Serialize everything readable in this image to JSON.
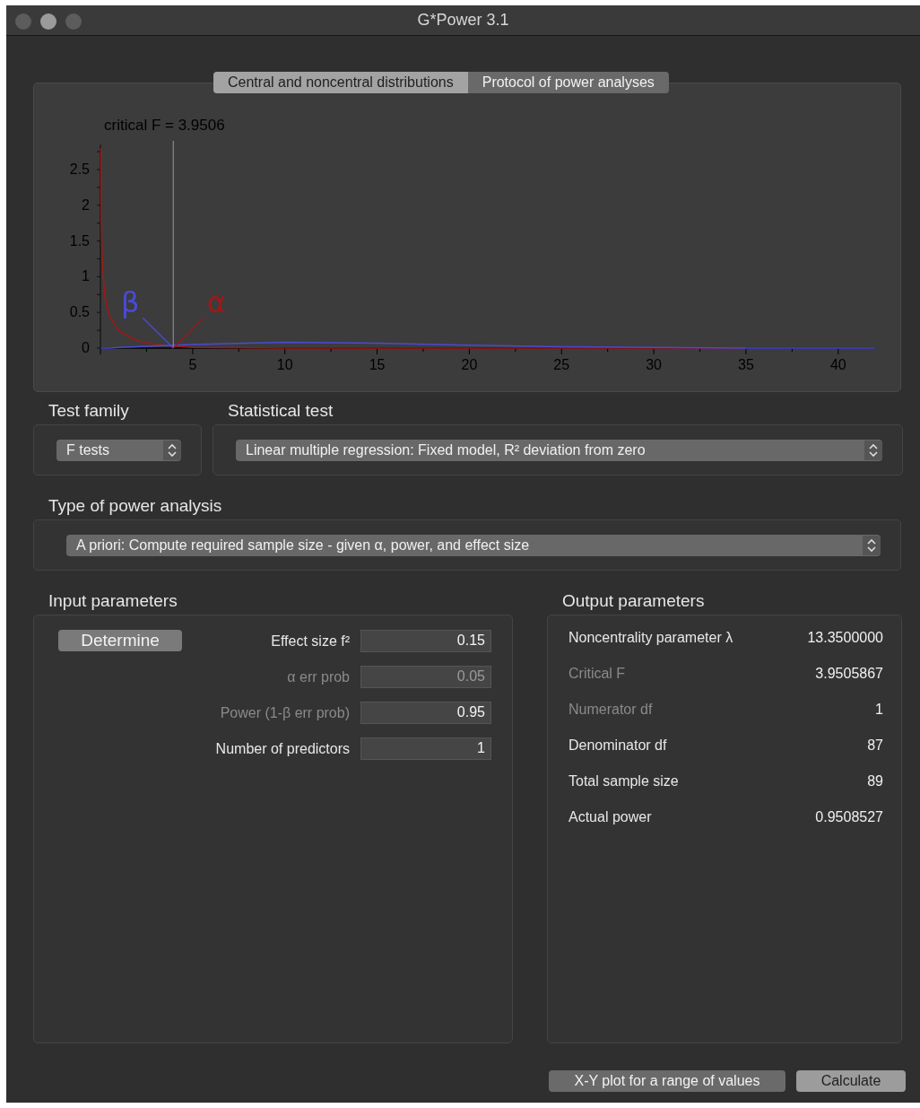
{
  "window": {
    "title": "G*Power 3.1"
  },
  "tabs": [
    {
      "label": "Central and noncentral distributions",
      "selected": true
    },
    {
      "label": "Protocol of power analyses",
      "selected": false
    }
  ],
  "distribution_plot": {
    "chart_data": {
      "type": "line",
      "xlim": [
        0,
        42
      ],
      "ylim": [
        0,
        2.85
      ],
      "xticks": [
        5,
        10,
        15,
        20,
        25,
        30,
        35,
        40
      ],
      "yticks": [
        0,
        0.5,
        1,
        1.5,
        2,
        2.5
      ],
      "x": [
        0.02,
        0.05,
        0.1,
        0.25,
        0.5,
        1,
        2,
        3,
        3.95,
        5,
        10,
        15,
        20,
        25,
        30,
        35,
        40,
        42
      ],
      "series": [
        {
          "color": "#a01818",
          "values": [
            2.8,
            1.74,
            1.2,
            0.7,
            0.44,
            0.24,
            0.1,
            0.05,
            0.03,
            0.01,
            0,
            0,
            0,
            0,
            0,
            0,
            null,
            null
          ]
        },
        {
          "color": "#4a4ad8",
          "values": [
            0,
            0,
            0,
            0,
            0,
            0.01,
            0.02,
            0.03,
            0.04,
            0.05,
            0.08,
            0.07,
            0.04,
            0.02,
            0.01,
            0,
            0,
            0
          ]
        }
      ],
      "ref_lines": [
        {
          "axis": "x",
          "value": 3.9506
        }
      ],
      "annotations": [
        "critical F = 3.9506",
        "β",
        "α"
      ]
    }
  },
  "test_family": {
    "label": "Test family",
    "value": "F tests"
  },
  "statistical_test": {
    "label": "Statistical test",
    "value": "Linear multiple regression: Fixed model, R² deviation from zero"
  },
  "power_analysis_type": {
    "label": "Type of power analysis",
    "value": "A priori: Compute required sample size - given α, power, and effect size"
  },
  "input_parameters": {
    "title": "Input parameters",
    "determine_button": "Determine",
    "rows": [
      {
        "label": "Effect size f²",
        "value": "0.15",
        "label_dimmed": false,
        "value_dimmed": false
      },
      {
        "label": "α err prob",
        "value": "0.05",
        "label_dimmed": true,
        "value_dimmed": true
      },
      {
        "label": "Power (1-β err prob)",
        "value": "0.95",
        "label_dimmed": true,
        "value_dimmed": false
      },
      {
        "label": "Number of predictors",
        "value": "1",
        "label_dimmed": false,
        "value_dimmed": false
      }
    ]
  },
  "output_parameters": {
    "title": "Output parameters",
    "rows": [
      {
        "label": "Noncentrality parameter λ",
        "value": "13.3500000",
        "label_dimmed": false
      },
      {
        "label": "Critical F",
        "value": "3.9505867",
        "label_dimmed": true
      },
      {
        "label": "Numerator df",
        "value": "1",
        "label_dimmed": true
      },
      {
        "label": "Denominator df",
        "value": "87",
        "label_dimmed": false
      },
      {
        "label": "Total sample size",
        "value": "89",
        "label_dimmed": false
      },
      {
        "label": "Actual power",
        "value": "0.9508527",
        "label_dimmed": false
      }
    ]
  },
  "buttons": [
    {
      "label": "X-Y plot for a range of values",
      "kind": "normal"
    },
    {
      "label": "Calculate",
      "kind": "default"
    }
  ]
}
